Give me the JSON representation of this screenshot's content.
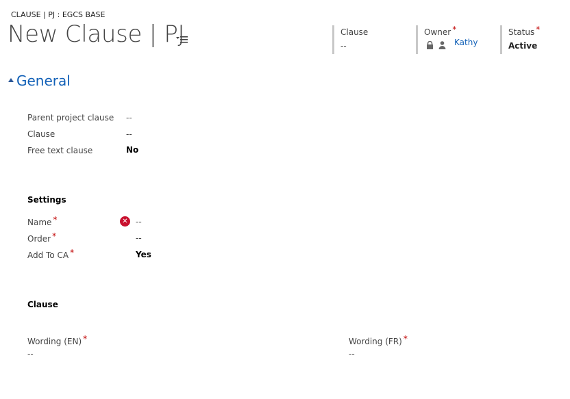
{
  "breadcrumb": "CLAUSE | PJ : EGCS BASE",
  "page_title": "New Clause | PJ",
  "header_fields": {
    "clause": {
      "label": "Clause",
      "value": "--"
    },
    "owner": {
      "label": "Owner",
      "required": "*",
      "value": "Kathy"
    },
    "status": {
      "label": "Status",
      "required": "*",
      "value": "Active"
    }
  },
  "section": {
    "title": "General"
  },
  "general_fields": [
    {
      "label": "Parent project clause",
      "value": "--"
    },
    {
      "label": "Clause",
      "value": "--"
    },
    {
      "label": "Free text clause",
      "value": "No"
    }
  ],
  "settings": {
    "heading": "Settings",
    "fields": [
      {
        "label": "Name",
        "required": "*",
        "value": "--"
      },
      {
        "label": "Order",
        "required": "*",
        "value": "--"
      },
      {
        "label": "Add To CA",
        "required": "*",
        "value": "Yes"
      }
    ]
  },
  "clause_section": {
    "heading": "Clause",
    "wording_en": {
      "label": "Wording (EN)",
      "required": "*",
      "value": "--"
    },
    "wording_fr": {
      "label": "Wording (FR)",
      "required": "*",
      "value": "--"
    }
  },
  "colors": {
    "accent": "#1160b7",
    "required": "#c00000",
    "error": "#c8102e"
  },
  "icons": [
    "command-menu-icon",
    "lock-icon",
    "user-icon",
    "collapse-arrow-icon",
    "error-icon"
  ]
}
